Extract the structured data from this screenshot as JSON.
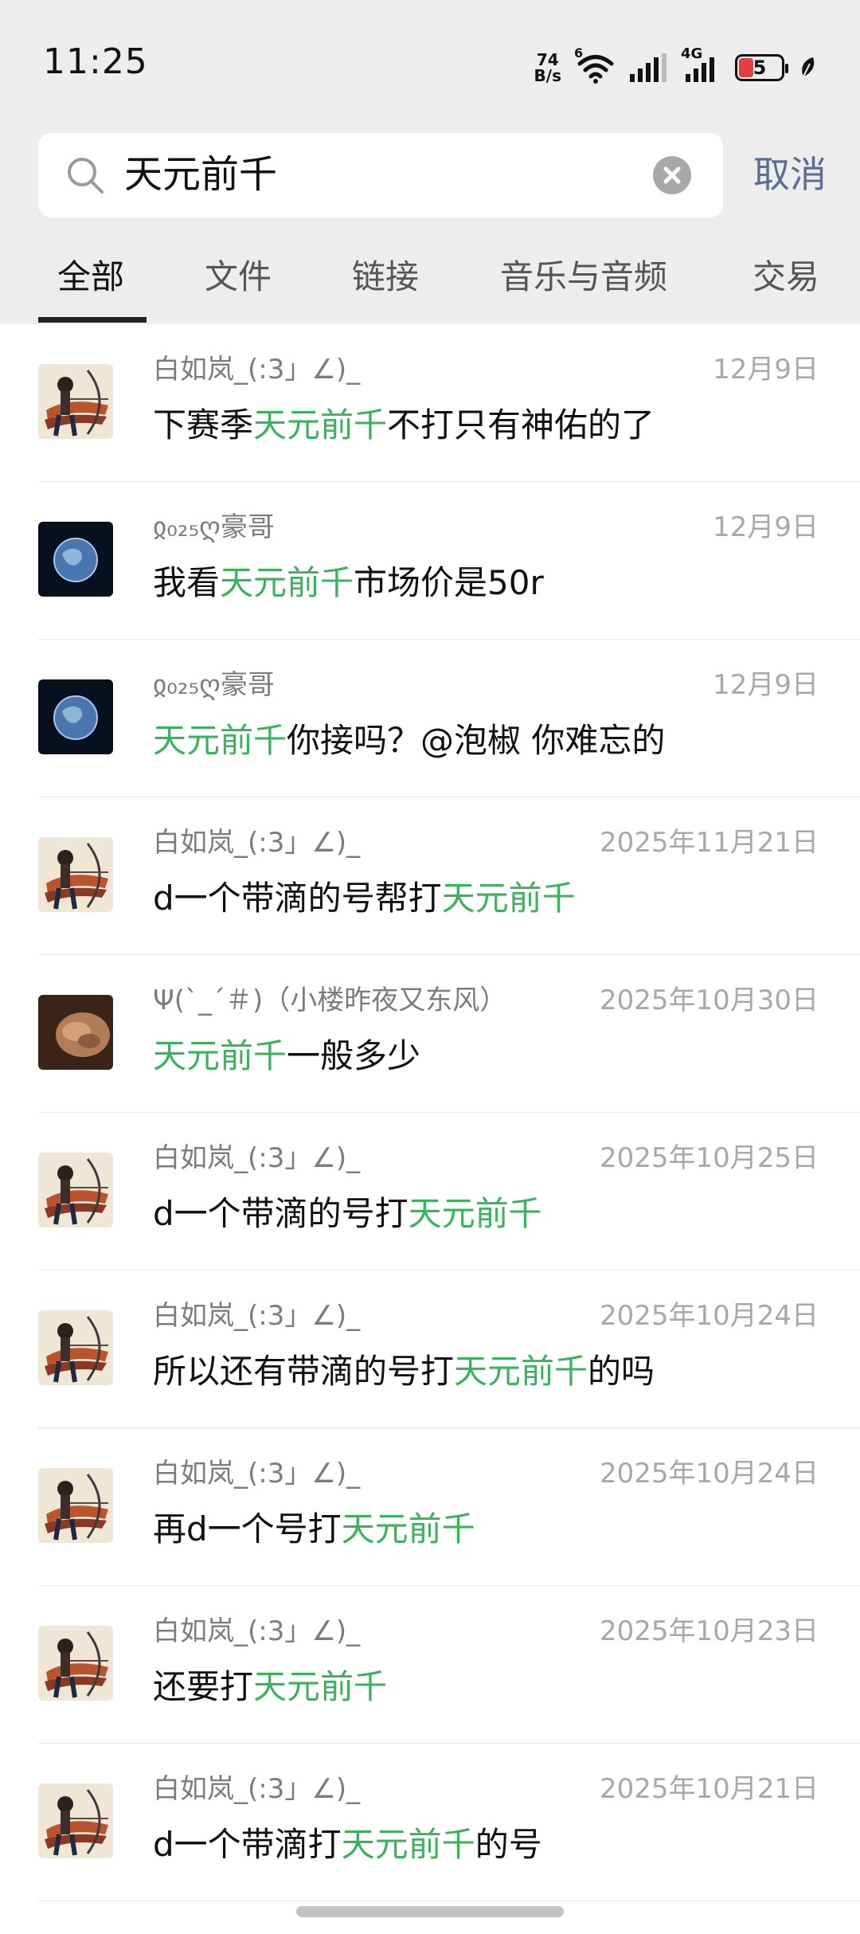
{
  "status_bar": {
    "time": "11:25",
    "net_speed_value": "74",
    "net_speed_unit": "B/s",
    "wifi_badge": "6",
    "cell_label": "4G",
    "battery_level": "5"
  },
  "search": {
    "query": "天元前千",
    "cancel_label": "取消"
  },
  "tabs": [
    {
      "label": "全部",
      "active": true
    },
    {
      "label": "文件"
    },
    {
      "label": "链接"
    },
    {
      "label": "音乐与音频"
    },
    {
      "label": "交易"
    }
  ],
  "highlight_color": "#39b35c",
  "results": [
    {
      "avatar": "girl-archer-avatar",
      "name": "白如岚_(:3」∠)_",
      "date": "12月9日",
      "before": "下赛季",
      "match": "天元前千",
      "after": "不打只有神佑的了"
    },
    {
      "avatar": "earth-avatar",
      "name": "ჲ₀₂₅ღ豪哥",
      "date": "12月9日",
      "before": "我看",
      "match": "天元前千",
      "after": "市场价是50r"
    },
    {
      "avatar": "earth-avatar",
      "name": "ჲ₀₂₅ღ豪哥",
      "date": "12月9日",
      "before": "",
      "match": "天元前千",
      "after": "你接吗？@泡椒 你难忘的"
    },
    {
      "avatar": "girl-archer-avatar",
      "name": "白如岚_(:3」∠)_",
      "date": "2025年11月21日",
      "before": "d一个带滴的号帮打",
      "match": "天元前千",
      "after": ""
    },
    {
      "avatar": "photo-avatar",
      "name": "Ψ(`_´＃)（小楼昨夜又东风）",
      "date": "2025年10月30日",
      "before": "",
      "match": "天元前千",
      "after": "一般多少"
    },
    {
      "avatar": "girl-archer-avatar",
      "name": "白如岚_(:3」∠)_",
      "date": "2025年10月25日",
      "before": "d一个带滴的号打",
      "match": "天元前千",
      "after": ""
    },
    {
      "avatar": "girl-archer-avatar",
      "name": "白如岚_(:3」∠)_",
      "date": "2025年10月24日",
      "before": "所以还有带滴的号打",
      "match": "天元前千",
      "after": "的吗"
    },
    {
      "avatar": "girl-archer-avatar",
      "name": "白如岚_(:3」∠)_",
      "date": "2025年10月24日",
      "before": "再d一个号打",
      "match": "天元前千",
      "after": ""
    },
    {
      "avatar": "girl-archer-avatar",
      "name": "白如岚_(:3」∠)_",
      "date": "2025年10月23日",
      "before": "还要打",
      "match": "天元前千",
      "after": ""
    },
    {
      "avatar": "girl-archer-avatar",
      "name": "白如岚_(:3」∠)_",
      "date": "2025年10月21日",
      "before": "d一个带滴打",
      "match": "天元前千",
      "after": "的号"
    }
  ]
}
